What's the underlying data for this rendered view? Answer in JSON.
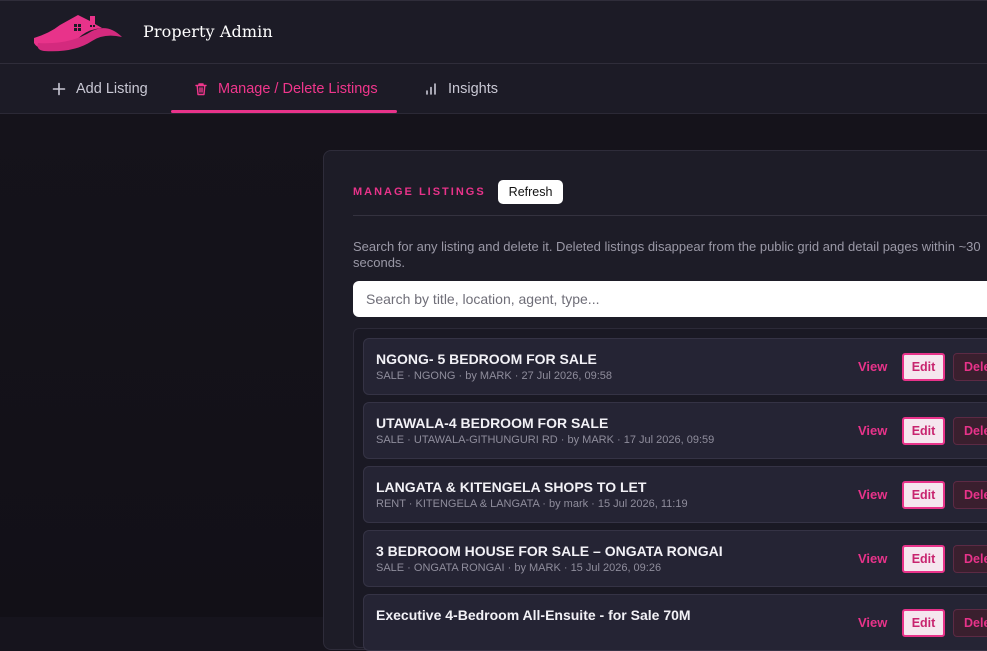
{
  "app": {
    "title": "Property Admin"
  },
  "tabs": [
    {
      "label": "Add Listing",
      "icon": "plus-icon"
    },
    {
      "label": "Manage / Delete Listings",
      "icon": "trash-icon",
      "active": true
    },
    {
      "label": "Insights",
      "icon": "bar-chart-icon"
    }
  ],
  "manage": {
    "title": "MANAGE LISTINGS",
    "refresh_label": "Refresh",
    "help_text": "Search for any listing and delete it. Deleted listings disappear from the public grid and detail pages within ~30 seconds.",
    "search_placeholder": "Search by title, location, agent, type..."
  },
  "listings": [
    {
      "title": "NGONG- 5 BEDROOM FOR SALE",
      "meta": "SALE · NGONG · by MARK · 27 Jul 2026, 09:58",
      "view_label": "View",
      "edit_label": "Edit",
      "delete_label": "Delete"
    },
    {
      "title": "UTAWALA-4 BEDROOM FOR SALE",
      "meta": "SALE · UTAWALA-GITHUNGURI RD · by MARK · 17 Jul 2026, 09:59",
      "view_label": "View",
      "edit_label": "Edit",
      "delete_label": "Delete"
    },
    {
      "title": "LANGATA & KITENGELA SHOPS TO LET",
      "meta": "RENT · KITENGELA & LANGATA · by mark · 15 Jul 2026, 11:19",
      "view_label": "View",
      "edit_label": "Edit",
      "delete_label": "Delete"
    },
    {
      "title": "3 BEDROOM HOUSE FOR SALE – ONGATA RONGAI",
      "meta": "SALE · ONGATA RONGAI · by MARK · 15 Jul 2026, 09:26",
      "view_label": "View",
      "edit_label": "Edit",
      "delete_label": "Delete"
    },
    {
      "title": "Executive 4-Bedroom All-Ensuite - for Sale 70M",
      "meta": "",
      "view_label": "View",
      "edit_label": "Edit",
      "delete_label": "Delete"
    }
  ],
  "colors": {
    "accent": "#e8338a",
    "background": "#16141d",
    "panel": "#1d1c27"
  }
}
